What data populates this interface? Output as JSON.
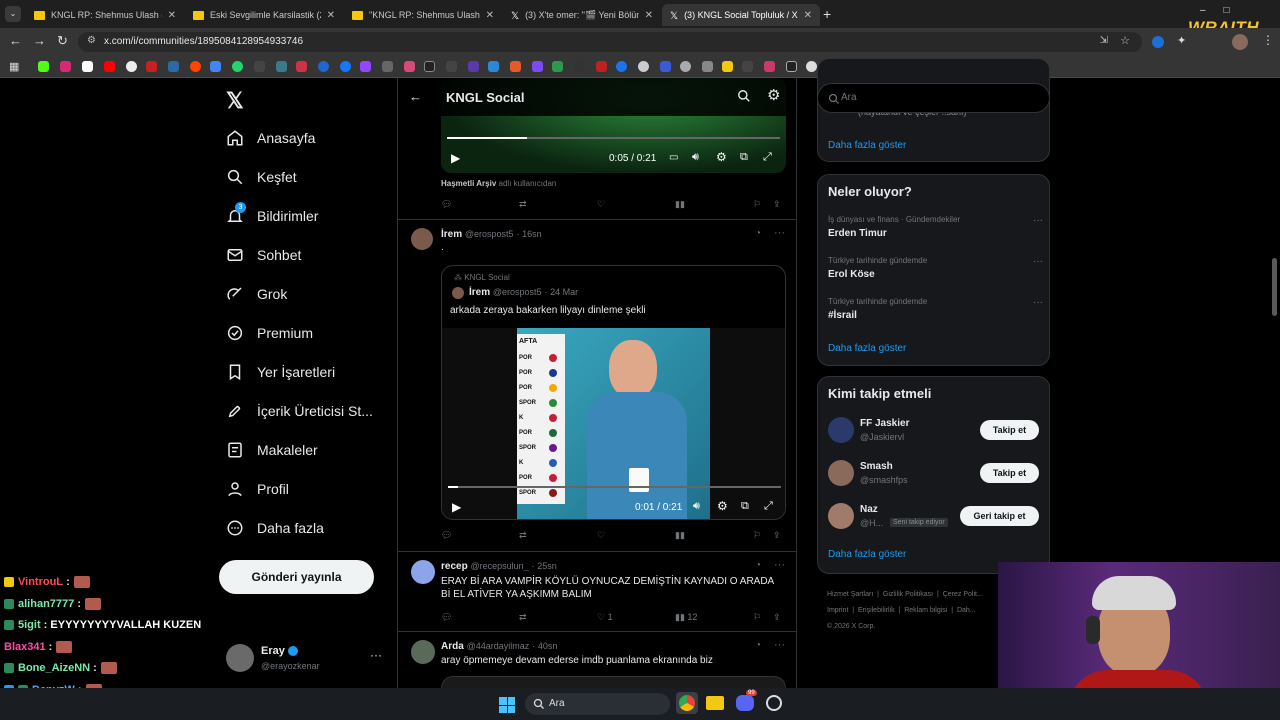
{
  "browser": {
    "tabs": [
      {
        "title": "KNGL RP: Shehmus Ulash (TV S",
        "icon": "yellow-favicon"
      },
      {
        "title": "Eski Sevgilimle Karsilastik (2026",
        "icon": "yellow-favicon"
      },
      {
        "title": "\"KNGL RP: Shehmus Ulash\" Esk",
        "icon": "yellow-favicon"
      },
      {
        "title": "(3) X'te omer: \"🎬 Yeni Bölüm",
        "icon": "x-icon"
      },
      {
        "title": "(3) KNGL Social Topluluk / X",
        "icon": "x-icon",
        "active": true
      }
    ],
    "url": "x.com/i/communities/1895084128954933746",
    "overlay_logo": "WRAITH"
  },
  "sidebar": {
    "items": [
      {
        "label": "Anasayfa",
        "icon": "home-icon"
      },
      {
        "label": "Keşfet",
        "icon": "search-icon"
      },
      {
        "label": "Bildirimler",
        "icon": "bell-icon",
        "badge": "3"
      },
      {
        "label": "Sohbet",
        "icon": "mail-icon"
      },
      {
        "label": "Grok",
        "icon": "grok-icon"
      },
      {
        "label": "Premium",
        "icon": "premium-icon"
      },
      {
        "label": "Yer İşaretleri",
        "icon": "bookmark-icon"
      },
      {
        "label": "İçerik Üreticisi St...",
        "icon": "rocket-icon"
      },
      {
        "label": "Makaleler",
        "icon": "article-icon"
      },
      {
        "label": "Profil",
        "icon": "person-icon"
      },
      {
        "label": "Daha fazla",
        "icon": "more-circle-icon"
      }
    ],
    "post_button": "Gönderi yayınla",
    "account": {
      "name": "Eray",
      "handle": "@erayozkenar"
    }
  },
  "header": {
    "title": "KNGL Social"
  },
  "feed": {
    "top_video": {
      "time": "0:05 / 0:21",
      "progress": 0.24,
      "caption_user": "Haşmetli Arşiv",
      "caption_rest": "adlı kullanıcıdan"
    },
    "posts": [
      {
        "name": "İrem",
        "handle": "@erospost5",
        "time": "16sn",
        "text": ".",
        "quote": {
          "community": "KNGL Social",
          "name": "İrem",
          "handle": "@erospost5",
          "date": "24 Mar",
          "text": "arkada zeraya bakarken lilyayı dinleme şekli",
          "video_time": "0:01 / 0:21",
          "progress": 0.03,
          "board_label": "AFTA",
          "board_rows": [
            "POR",
            "POR",
            "POR",
            "SPOR",
            "K",
            "POR",
            "SPOR",
            "K",
            "POR",
            "SPOR"
          ]
        }
      },
      {
        "name": "recep",
        "handle": "@recepsulun_",
        "time": "25sn",
        "text": "ERAY Bİ ARA VAMPİR KÖYLÜ OYNUCAZ DEMİŞTİN KAYNADI O ARADA Bİ EL ATİVER YA AŞKIMM BALIM",
        "likes": "1",
        "views": "12"
      },
      {
        "name": "Arda",
        "handle": "@44ardayilmaz",
        "time": "40sn",
        "text": "aray öpmemeye devam ederse imdb puanlama ekranında biz"
      }
    ]
  },
  "right": {
    "search_placeholder": "Ara",
    "top_partial": "(hayatandı ve çeşler ..sanı)",
    "show_more": "Daha fazla göster",
    "trends_title": "Neler oluyor?",
    "trends": [
      {
        "category": "İş dünyası ve finans · Gündemdekiler",
        "name": "Erden Timur"
      },
      {
        "category": "Türkiye tarihinde gündemde",
        "name": "Erol Köse"
      },
      {
        "category": "Türkiye tarihinde gündemde",
        "name": "#İsrail"
      }
    ],
    "who_title": "Kimi takip etmeli",
    "who": [
      {
        "name": "FF Jaskier",
        "handle": "@Jaskiervl",
        "button": "Takip et"
      },
      {
        "name": "Smash",
        "handle": "@smashfps",
        "button": "Takip et"
      },
      {
        "name": "Naz",
        "handle": "@H...",
        "badge": "Seni takip ediyor",
        "button": "Geri takip et"
      }
    ],
    "footer": [
      "Hizmet Şartları",
      "Gizlilik Politikası",
      "Çerez Polit...",
      "Imprint",
      "Erişilebilirlik",
      "Reklam bilgisi",
      "Dah...",
      "© 2026 X Corp."
    ]
  },
  "chat": [
    {
      "user": "VintrouL",
      "color": "#ff4d4d",
      "msg": ""
    },
    {
      "user": "alihan7777",
      "color": "#7ee8a8",
      "msg": ""
    },
    {
      "user": "5igit",
      "color": "#7ee8a8",
      "msg": "EYYYYYYYYVALLAH KUZEN"
    },
    {
      "user": "Blax341",
      "color": "#ff4da6",
      "msg": ""
    },
    {
      "user": "Bone_AizeNN",
      "color": "#7ee8a8",
      "msg": ""
    },
    {
      "user": "DenyzW",
      "color": "#5aa9ff",
      "msg": ""
    },
    {
      "user": "burAlkr",
      "color": "#7ee8a8",
      "msg": ""
    }
  ],
  "taskbar": {
    "search": "Ara",
    "discord_badge": "99"
  }
}
